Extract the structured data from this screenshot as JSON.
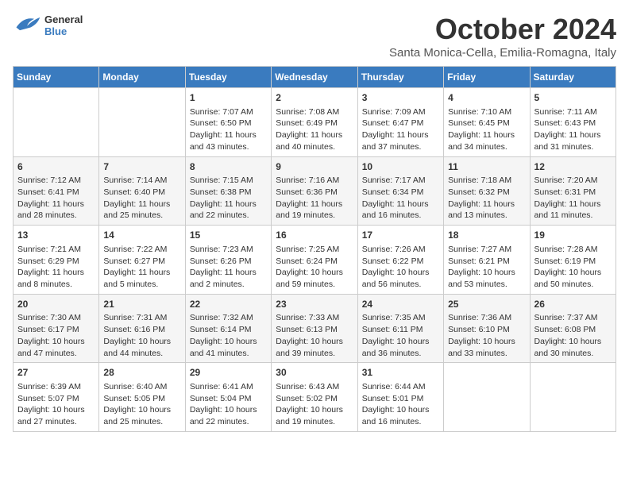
{
  "header": {
    "logo_general": "General",
    "logo_blue": "Blue",
    "month": "October 2024",
    "location": "Santa Monica-Cella, Emilia-Romagna, Italy"
  },
  "weekdays": [
    "Sunday",
    "Monday",
    "Tuesday",
    "Wednesday",
    "Thursday",
    "Friday",
    "Saturday"
  ],
  "weeks": [
    [
      {
        "day": "",
        "info": ""
      },
      {
        "day": "",
        "info": ""
      },
      {
        "day": "1",
        "info": "Sunrise: 7:07 AM\nSunset: 6:50 PM\nDaylight: 11 hours and 43 minutes."
      },
      {
        "day": "2",
        "info": "Sunrise: 7:08 AM\nSunset: 6:49 PM\nDaylight: 11 hours and 40 minutes."
      },
      {
        "day": "3",
        "info": "Sunrise: 7:09 AM\nSunset: 6:47 PM\nDaylight: 11 hours and 37 minutes."
      },
      {
        "day": "4",
        "info": "Sunrise: 7:10 AM\nSunset: 6:45 PM\nDaylight: 11 hours and 34 minutes."
      },
      {
        "day": "5",
        "info": "Sunrise: 7:11 AM\nSunset: 6:43 PM\nDaylight: 11 hours and 31 minutes."
      }
    ],
    [
      {
        "day": "6",
        "info": "Sunrise: 7:12 AM\nSunset: 6:41 PM\nDaylight: 11 hours and 28 minutes."
      },
      {
        "day": "7",
        "info": "Sunrise: 7:14 AM\nSunset: 6:40 PM\nDaylight: 11 hours and 25 minutes."
      },
      {
        "day": "8",
        "info": "Sunrise: 7:15 AM\nSunset: 6:38 PM\nDaylight: 11 hours and 22 minutes."
      },
      {
        "day": "9",
        "info": "Sunrise: 7:16 AM\nSunset: 6:36 PM\nDaylight: 11 hours and 19 minutes."
      },
      {
        "day": "10",
        "info": "Sunrise: 7:17 AM\nSunset: 6:34 PM\nDaylight: 11 hours and 16 minutes."
      },
      {
        "day": "11",
        "info": "Sunrise: 7:18 AM\nSunset: 6:32 PM\nDaylight: 11 hours and 13 minutes."
      },
      {
        "day": "12",
        "info": "Sunrise: 7:20 AM\nSunset: 6:31 PM\nDaylight: 11 hours and 11 minutes."
      }
    ],
    [
      {
        "day": "13",
        "info": "Sunrise: 7:21 AM\nSunset: 6:29 PM\nDaylight: 11 hours and 8 minutes."
      },
      {
        "day": "14",
        "info": "Sunrise: 7:22 AM\nSunset: 6:27 PM\nDaylight: 11 hours and 5 minutes."
      },
      {
        "day": "15",
        "info": "Sunrise: 7:23 AM\nSunset: 6:26 PM\nDaylight: 11 hours and 2 minutes."
      },
      {
        "day": "16",
        "info": "Sunrise: 7:25 AM\nSunset: 6:24 PM\nDaylight: 10 hours and 59 minutes."
      },
      {
        "day": "17",
        "info": "Sunrise: 7:26 AM\nSunset: 6:22 PM\nDaylight: 10 hours and 56 minutes."
      },
      {
        "day": "18",
        "info": "Sunrise: 7:27 AM\nSunset: 6:21 PM\nDaylight: 10 hours and 53 minutes."
      },
      {
        "day": "19",
        "info": "Sunrise: 7:28 AM\nSunset: 6:19 PM\nDaylight: 10 hours and 50 minutes."
      }
    ],
    [
      {
        "day": "20",
        "info": "Sunrise: 7:30 AM\nSunset: 6:17 PM\nDaylight: 10 hours and 47 minutes."
      },
      {
        "day": "21",
        "info": "Sunrise: 7:31 AM\nSunset: 6:16 PM\nDaylight: 10 hours and 44 minutes."
      },
      {
        "day": "22",
        "info": "Sunrise: 7:32 AM\nSunset: 6:14 PM\nDaylight: 10 hours and 41 minutes."
      },
      {
        "day": "23",
        "info": "Sunrise: 7:33 AM\nSunset: 6:13 PM\nDaylight: 10 hours and 39 minutes."
      },
      {
        "day": "24",
        "info": "Sunrise: 7:35 AM\nSunset: 6:11 PM\nDaylight: 10 hours and 36 minutes."
      },
      {
        "day": "25",
        "info": "Sunrise: 7:36 AM\nSunset: 6:10 PM\nDaylight: 10 hours and 33 minutes."
      },
      {
        "day": "26",
        "info": "Sunrise: 7:37 AM\nSunset: 6:08 PM\nDaylight: 10 hours and 30 minutes."
      }
    ],
    [
      {
        "day": "27",
        "info": "Sunrise: 6:39 AM\nSunset: 5:07 PM\nDaylight: 10 hours and 27 minutes."
      },
      {
        "day": "28",
        "info": "Sunrise: 6:40 AM\nSunset: 5:05 PM\nDaylight: 10 hours and 25 minutes."
      },
      {
        "day": "29",
        "info": "Sunrise: 6:41 AM\nSunset: 5:04 PM\nDaylight: 10 hours and 22 minutes."
      },
      {
        "day": "30",
        "info": "Sunrise: 6:43 AM\nSunset: 5:02 PM\nDaylight: 10 hours and 19 minutes."
      },
      {
        "day": "31",
        "info": "Sunrise: 6:44 AM\nSunset: 5:01 PM\nDaylight: 10 hours and 16 minutes."
      },
      {
        "day": "",
        "info": ""
      },
      {
        "day": "",
        "info": ""
      }
    ]
  ]
}
